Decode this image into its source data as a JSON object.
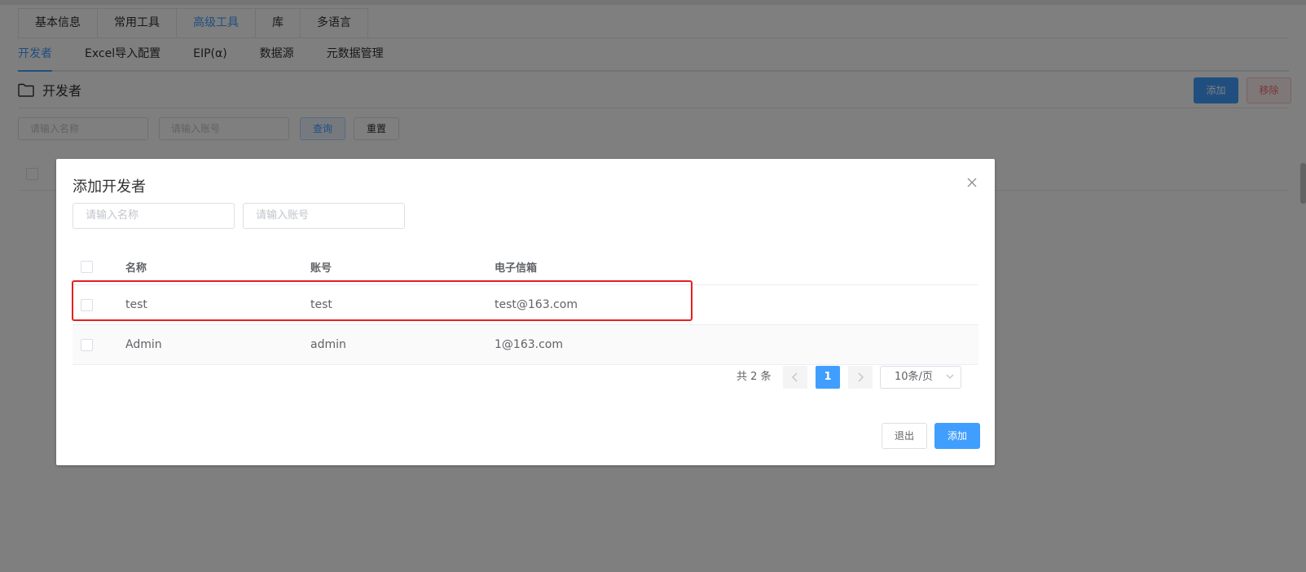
{
  "tabs": [
    "基本信息",
    "常用工具",
    "高级工具",
    "库",
    "多语言"
  ],
  "active_tab": 2,
  "subtabs": [
    "开发者",
    "Excel导入配置",
    "EIP(α)",
    "数据源",
    "元数据管理"
  ],
  "active_subtab": 0,
  "section": {
    "title": "开发者",
    "add_label": "添加",
    "remove_label": "移除",
    "name_placeholder": "请输入名称",
    "account_placeholder": "请输入账号",
    "query_label": "查询",
    "reset_label": "重置"
  },
  "dialog": {
    "title": "添加开发者",
    "name_placeholder": "请输入名称",
    "account_placeholder": "请输入账号",
    "columns": [
      "名称",
      "账号",
      "电子信箱"
    ],
    "rows": [
      {
        "name": "test",
        "account": "test",
        "email": "test@163.com"
      },
      {
        "name": "Admin",
        "account": "admin",
        "email": "1@163.com"
      }
    ],
    "pagination": {
      "total_text": "共 2 条",
      "current_page": "1",
      "page_size": "10条/页"
    },
    "exit_label": "退出",
    "add_label": "添加"
  },
  "colors": {
    "primary": "#409eff",
    "danger": "#f56c6c",
    "highlight": "#e52020"
  }
}
